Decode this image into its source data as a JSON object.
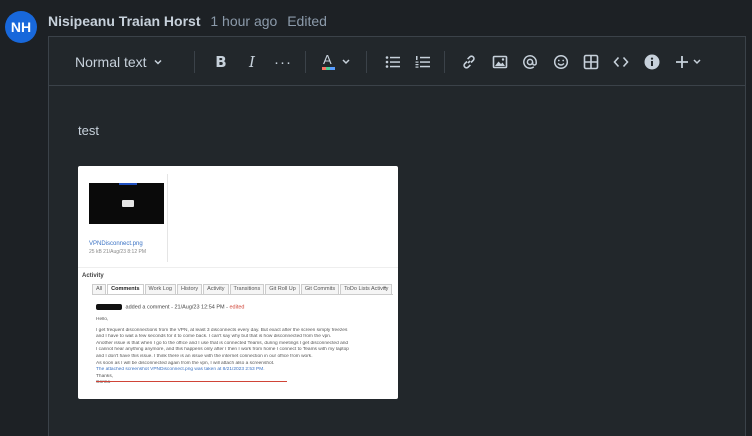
{
  "comment": {
    "avatar_initials": "NH",
    "avatar_color": "#1868db",
    "author": "Nisipeanu Traian Horst",
    "time": "1 hour ago",
    "status": "Edited"
  },
  "toolbar": {
    "text_style": "Normal text",
    "icons": [
      "bold-icon",
      "italic-icon",
      "more-formatting-icon",
      "text-color-icon",
      "bullet-list-icon",
      "numbered-list-icon",
      "link-icon",
      "image-icon",
      "mention-icon",
      "emoji-icon",
      "table-icon",
      "code-icon",
      "info-icon",
      "insert-more-icon"
    ],
    "bold_label": "B",
    "italic_label": "I",
    "more_label": "···",
    "text_color_accent": "#f87462"
  },
  "body": {
    "text": "test"
  },
  "attachment_screenshot": {
    "file_name": "VPNDisconnect.png",
    "file_meta": "25 kB     21/Aug/23 8:12 PM",
    "section_title": "Activity",
    "tabs": [
      "All",
      "Comments",
      "Work Log",
      "History",
      "Activity",
      "Transitions",
      "Git Roll Up",
      "Git Commits",
      "ToDo Lists Activity"
    ],
    "active_tab": "Comments",
    "comment_header": "added a comment - 21/Aug/23 12:54 PM -",
    "comment_edit": "edited",
    "lines": [
      "Hello,",
      "I get frequent disconnections from the VPN, at least 3 disconnects every day. But exact after the screen simply freezes",
      "and I have to wait a few seconds for it to come back. I can't say why but that is how disconnected from the vpn.",
      "Another issue is that when I go to the office and I use that is connected Teams, during meetings I get disconnected and",
      "I cannot hear anything anymore, and this happens only after I then I work from home I connect to Teams with my laptop",
      "and I don't have this issue. I think there is an issue with the internet connection in our office from work.",
      "As soon as I will be disconnected again from the vpn, I will attach also a screenshot.",
      "The attached screenshot VPNDisconnect.png was taken at 8/21/2023 2:53 PM.",
      "Thanks,",
      "Corina"
    ]
  }
}
